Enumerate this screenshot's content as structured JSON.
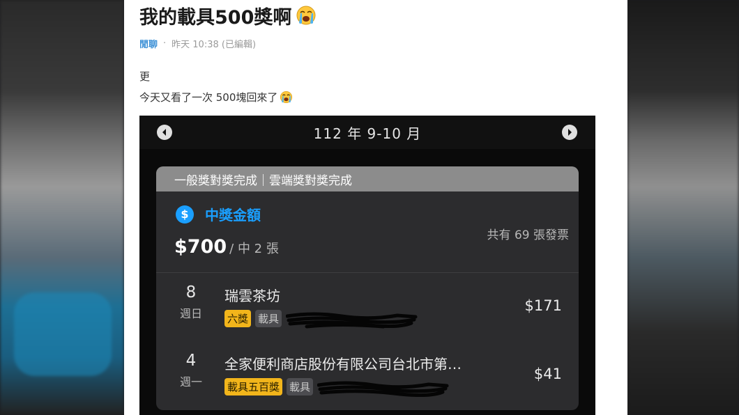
{
  "post": {
    "title": "我的載具500獎啊",
    "board": "閒聊",
    "separator": "·",
    "timestamp": "昨天 10:38 (已編輯)",
    "body_line1": "更",
    "body_line2": "今天又看了一次 500塊回來了"
  },
  "screenshot": {
    "period": "112 年 9-10 月",
    "status": "一般獎對獎完成｜雲端獎對獎完成",
    "prize_label": "中獎金額",
    "dollar_symbol": "$",
    "amount": "$700",
    "amount_sub": "/ 中 2 張",
    "invoice_count": "共有 69 張發票",
    "rows": [
      {
        "day": "8",
        "weekday": "週日",
        "store": "瑞雲茶坊",
        "prize_tag": "六獎",
        "carrier_tag": "載具",
        "price": "$171"
      },
      {
        "day": "4",
        "weekday": "週一",
        "store": "全家便利商店股份有限公司台北市第…",
        "prize_tag": "載具五百獎",
        "carrier_tag": "載具",
        "price": "$41"
      }
    ]
  },
  "colors": {
    "accent_blue": "#1a9fff",
    "prize_tag_yellow": "#f2b51b",
    "board_link": "#3a8fd6"
  },
  "icons": [
    "loudly-crying-face-icon",
    "dollar-circle-icon",
    "chevron-left-icon",
    "chevron-right-icon"
  ]
}
